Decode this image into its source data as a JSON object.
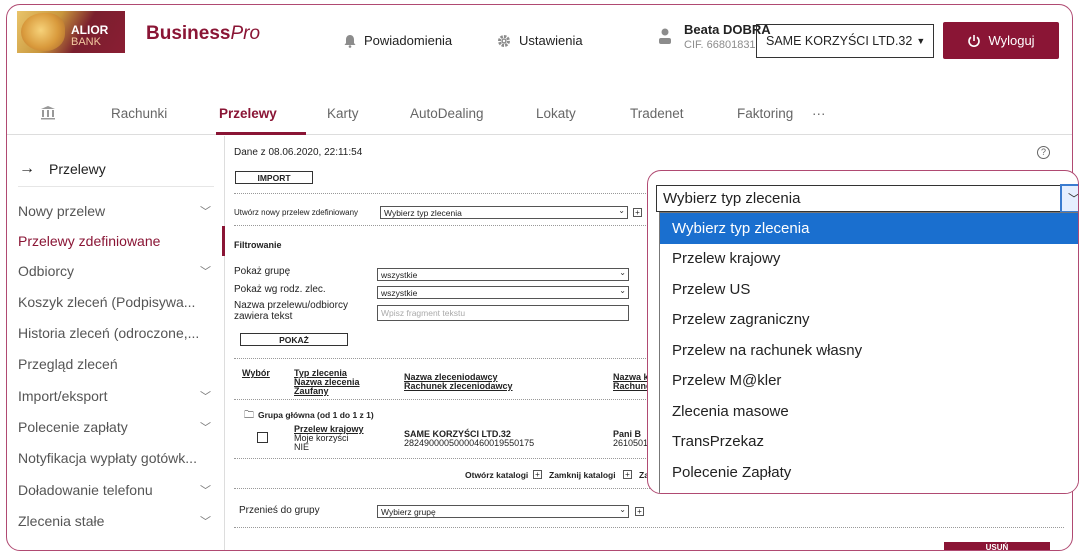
{
  "header": {
    "logo_line1": "ALIOR",
    "logo_line2": "BANK",
    "brand_main": "Business",
    "brand_italic": "Pro",
    "notifications_label": "Powiadomienia",
    "settings_label": "Ustawienia",
    "user_name": "Beata DOBRA",
    "user_cif": "CIF. 66801831",
    "company": "SAME KORZYŚCI LTD.32",
    "logout_label": "Wyloguj"
  },
  "nav": {
    "items": [
      "Rachunki",
      "Przelewy",
      "Karty",
      "AutoDealing",
      "Lokaty",
      "Tradenet",
      "Faktoring"
    ],
    "more": "···",
    "active": "Przelewy"
  },
  "sidebar": {
    "title": "Przelewy",
    "items": [
      {
        "label": "Nowy przelew",
        "chevron": true
      },
      {
        "label": "Przelewy zdefiniowane",
        "chevron": false,
        "active": true
      },
      {
        "label": "Odbiorcy",
        "chevron": true
      },
      {
        "label": "Koszyk zleceń (Podpisywa...",
        "chevron": false
      },
      {
        "label": "Historia zleceń (odroczone,...",
        "chevron": false
      },
      {
        "label": "Przegląd zleceń",
        "chevron": false
      },
      {
        "label": "Import/eksport",
        "chevron": true
      },
      {
        "label": "Polecenie zapłaty",
        "chevron": true
      },
      {
        "label": "Notyfikacja wypłaty gotówk...",
        "chevron": false
      },
      {
        "label": "Doładowanie telefonu",
        "chevron": true
      },
      {
        "label": "Zlecenia stałe",
        "chevron": true
      }
    ]
  },
  "content": {
    "data_date": "Dane z 08.06.2020, 22:11:54",
    "import_label": "IMPORT",
    "create_label": "Utwórz nowy przelew zdefiniowany",
    "create_select": "Wybierz typ zlecenia",
    "filter_heading": "Filtrowanie",
    "show_group_label": "Pokaż grupę",
    "show_group_value": "wszystkie",
    "show_type_label": "Pokaż wg rodz. zlec.",
    "show_type_value": "wszystkie",
    "name_label_1": "Nazwa przelewu/odbiorcy",
    "name_label_2": "zawiera tekst",
    "name_placeholder": "Wpisz fragment tekstu",
    "show_button": "POKAŻ",
    "table_headers": {
      "select": "Wybór",
      "type1": "Typ zlecenia",
      "type2": "Nazwa zlecenia",
      "type3": "Zaufany",
      "sender1": "Nazwa zleceniodawcy",
      "sender2": "Rachunek zleceniodawcy",
      "recv1": "Nazwa ko",
      "recv2": "Rachunek"
    },
    "group_label": "Grupa główna (od 1 do 1 z 1)",
    "row": {
      "type": "Przelew krajowy",
      "name": "Moje korzyści",
      "trusted": "NIE",
      "sender_name": "SAME KORZYŚCI LTD.32",
      "sender_account": "28249000050000460019550175",
      "recv_name": "Pani B",
      "recv_account": "26105014"
    },
    "open_catalogs": "Otwórz katalogi",
    "close_catalogs": "Zamknij katalogi",
    "more_trunc": "Zaz",
    "move_label": "Przenieś do grupy",
    "move_select": "Wybierz grupę",
    "delete_label": "USUŃ"
  },
  "dropdown": {
    "selected": "Wybierz typ zlecenia",
    "options": [
      "Wybierz typ zlecenia",
      "Przelew krajowy",
      "Przelew US",
      "Przelew zagraniczny",
      "Przelew na rachunek własny",
      "Przelew M@kler",
      "Zlecenia masowe",
      "TransPrzekaz",
      "Polecenie Zapłaty"
    ],
    "highlighted_index": 0
  }
}
